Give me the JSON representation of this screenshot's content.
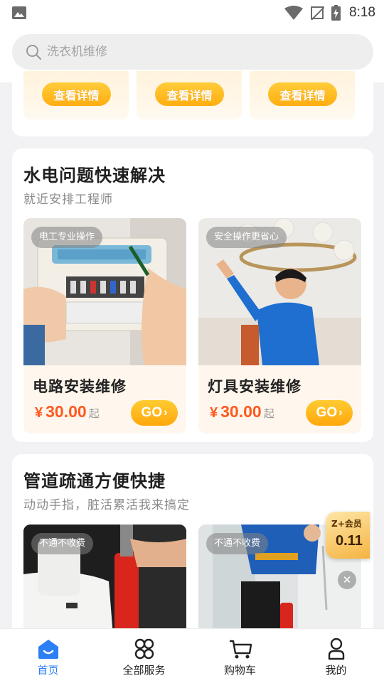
{
  "status_bar": {
    "time": "8:18"
  },
  "search": {
    "placeholder": "洗衣机维修"
  },
  "top_card": {
    "buttons": [
      "查看详情",
      "查看详情",
      "查看详情"
    ]
  },
  "section1": {
    "title": "水电问题快速解决",
    "subtitle": "就近安排工程师",
    "items": [
      {
        "tag": "电工专业操作",
        "name": "电路安装维修",
        "currency": "¥",
        "price": "30.00",
        "suffix": "起",
        "go": "GO"
      },
      {
        "tag": "安全操作更省心",
        "name": "灯具安装维修",
        "currency": "¥",
        "price": "30.00",
        "suffix": "起",
        "go": "GO"
      }
    ]
  },
  "section2": {
    "title": "管道疏通方便快捷",
    "subtitle": "动动手指，脏活累活我来搞定",
    "items": [
      {
        "tag": "不通不收费"
      },
      {
        "tag": "不通不收费"
      }
    ]
  },
  "vip_badge": {
    "line1": "Z+会员",
    "line2": "0.11"
  },
  "bottom_nav": [
    {
      "label": "首页",
      "icon": "home-icon",
      "active": true
    },
    {
      "label": "全部服务",
      "icon": "grid-icon",
      "active": false
    },
    {
      "label": "购物车",
      "icon": "cart-icon",
      "active": false
    },
    {
      "label": "我的",
      "icon": "user-icon",
      "active": false
    }
  ],
  "colors": {
    "accent_blue": "#2c7ff5",
    "price_orange": "#ff5a1f",
    "button_yellow": "#ffb81c"
  }
}
